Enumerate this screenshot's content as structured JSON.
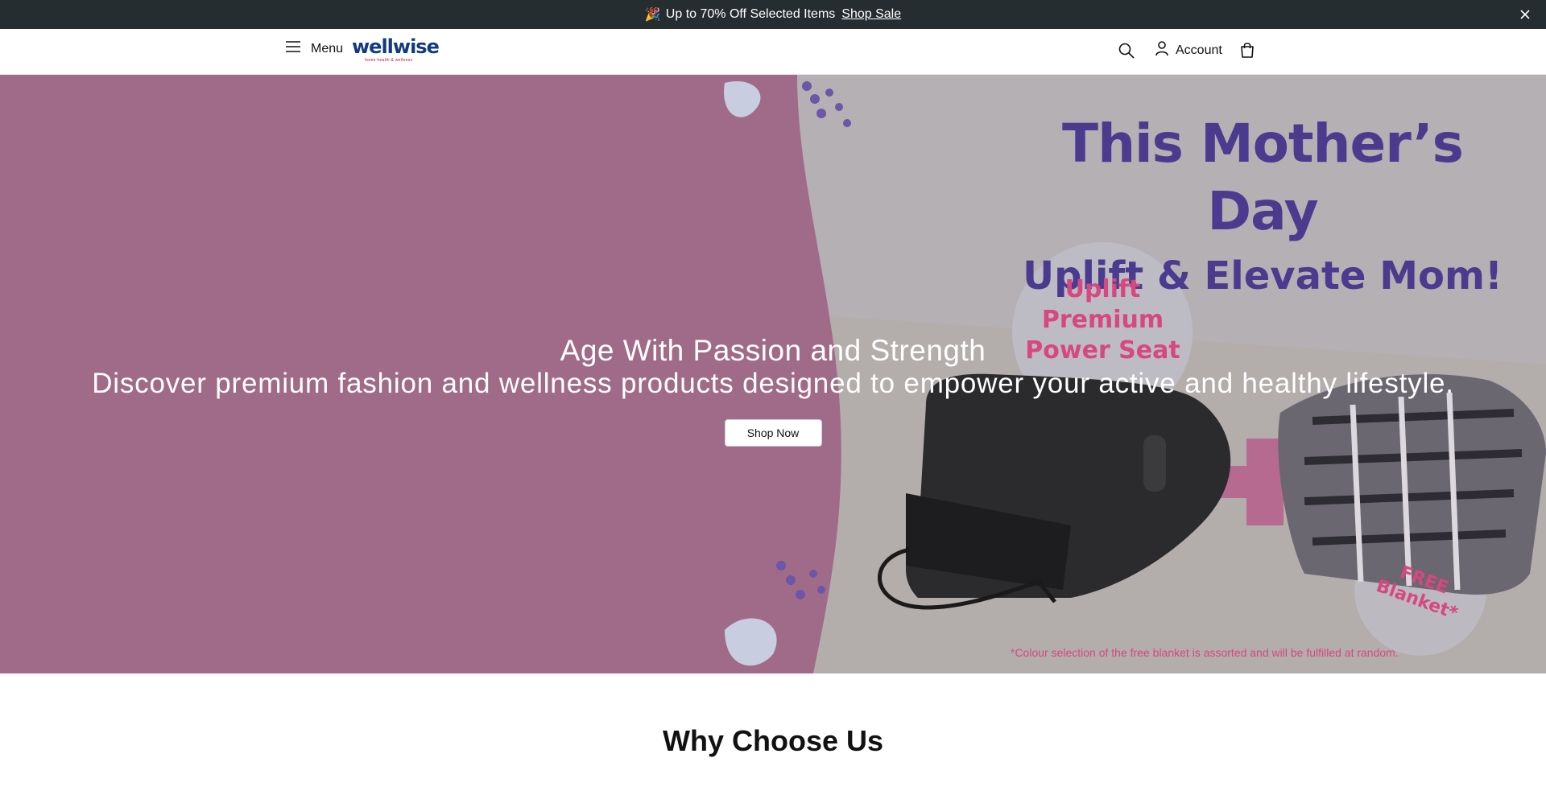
{
  "announcement": {
    "emoji": "🎉",
    "text": "Up to 70% Off Selected Items",
    "link_label": "Shop Sale"
  },
  "header": {
    "menu_label": "Menu",
    "logo_text": "wellwise",
    "logo_tagline": "home health & wellness",
    "account_label": "Account"
  },
  "hero": {
    "promo_line1": "This Mother’s Day",
    "promo_line2": "Uplift & Elevate Mom!",
    "badge_line1": "Uplift",
    "badge_line2": "Premium",
    "badge_line3": "Power Seat",
    "free_line1": "FREE",
    "free_line2": "Blanket*",
    "fineprint": "*Colour selection of the free blanket is assorted and will be fulfilled at random.",
    "headline": "Age With Passion and Strength",
    "subheadline": "Discover premium fashion and wellness products designed to empower your active and healthy lifestyle.",
    "cta_label": "Shop Now"
  },
  "section": {
    "title": "Why Choose Us"
  },
  "colors": {
    "announcement_bg": "#262d31",
    "hero_mauve": "#a06b88",
    "promo_purple": "#4b3b8e",
    "promo_pink": "#d6487f",
    "logo_blue": "#123a7d",
    "logo_red": "#c8102e"
  }
}
